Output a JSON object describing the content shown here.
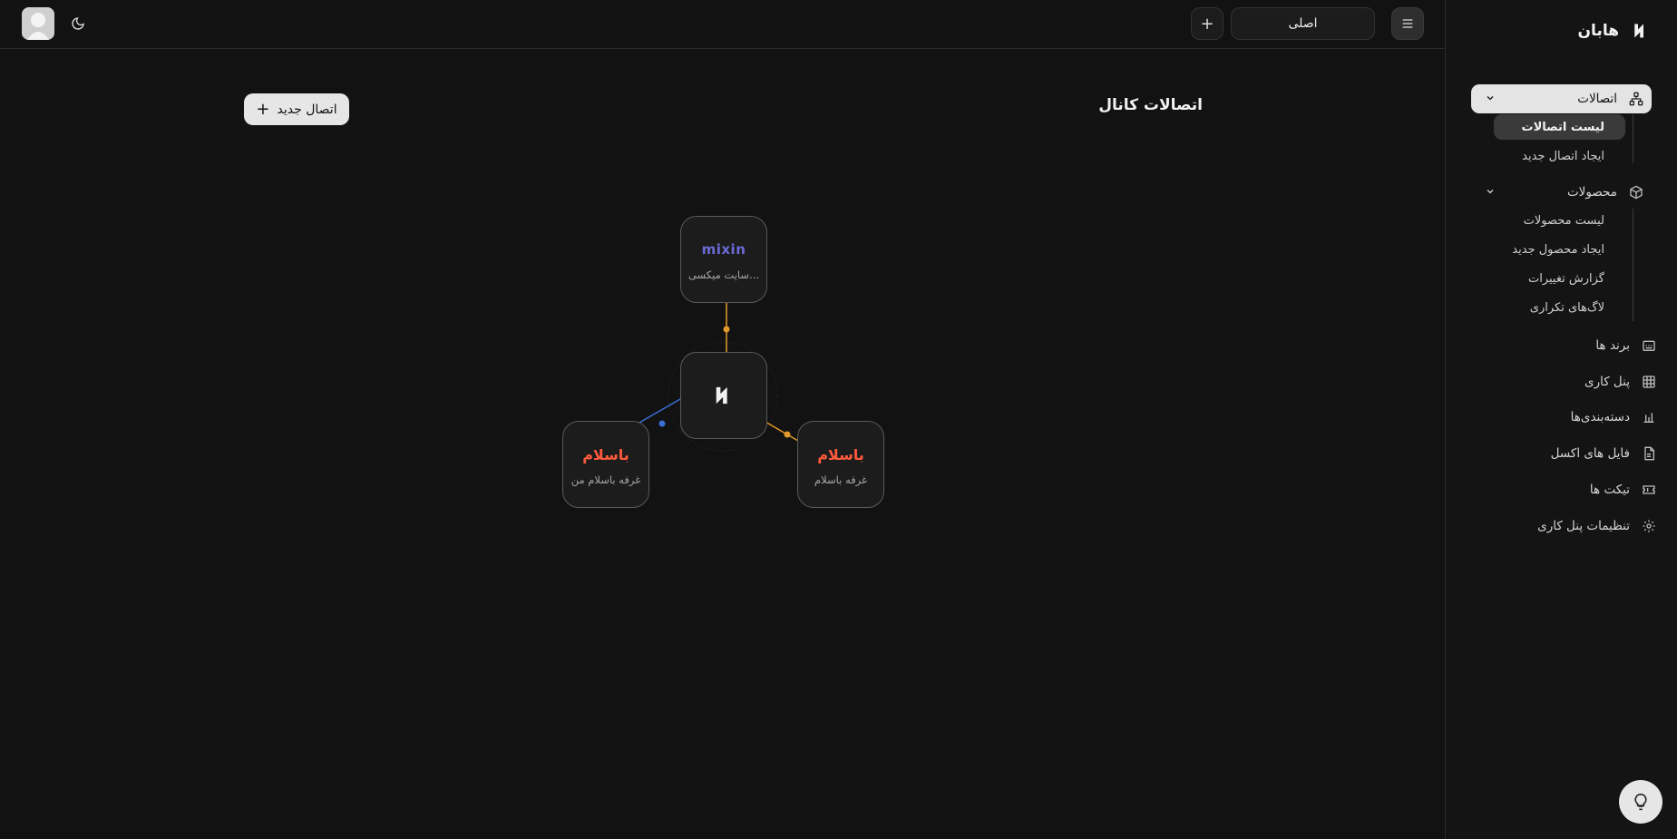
{
  "app": {
    "name": "هابان"
  },
  "topbar": {
    "workspace": "اصلی",
    "add_symbol": "+"
  },
  "sidebar": {
    "connections": {
      "label": "اتصالات",
      "items": [
        {
          "label": "لیست اتصالات"
        },
        {
          "label": "ایجاد اتصال جدید"
        }
      ]
    },
    "products": {
      "label": "محصولات",
      "items": [
        {
          "label": "لیست محصولات"
        },
        {
          "label": "ایجاد محصول جدید"
        },
        {
          "label": "گزارش تغییرات"
        },
        {
          "label": "لاگ‌های تکراری"
        }
      ]
    },
    "items": [
      {
        "label": "برند ها",
        "icon": "brands-icon"
      },
      {
        "label": "پنل کاری",
        "icon": "grid-icon"
      },
      {
        "label": "دسته‌بندی‌ها",
        "icon": "chart-icon"
      },
      {
        "label": "فایل های اکسل",
        "icon": "file-icon"
      },
      {
        "label": "تیکت ها",
        "icon": "ticket-icon"
      },
      {
        "label": "تنظیمات پنل کاری",
        "icon": "gear-icon"
      }
    ]
  },
  "main": {
    "title": "اتصالات کانال",
    "new_connection_label": "اتصال جدید",
    "nodes": {
      "top": {
        "logo": "mixin",
        "label": "سایت میکسی..."
      },
      "left": {
        "logo": "باسلام",
        "label": "غرفه باسلام من"
      },
      "right": {
        "logo": "باسلام",
        "label": "غرفه باسلام"
      }
    }
  },
  "colors": {
    "accent_orange": "#e39a2a",
    "accent_blue": "#3b6fd6",
    "basalam": "#ff5a3c",
    "mixin": "#6b6bd8"
  }
}
